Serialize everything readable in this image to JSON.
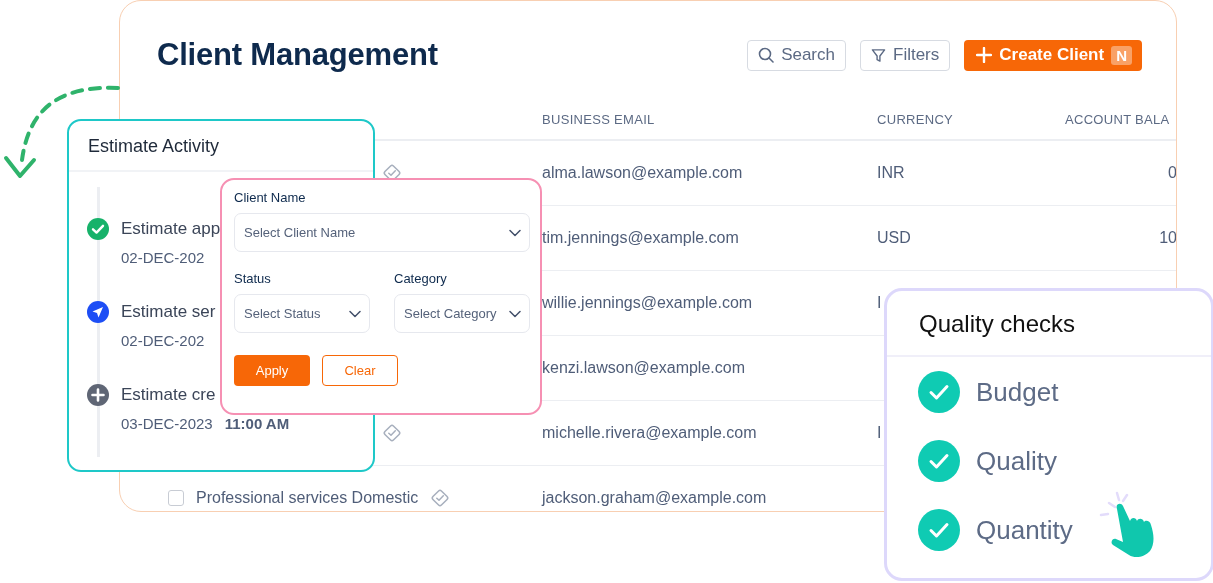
{
  "client_management": {
    "title": "Client Management",
    "toolbar": [
      {
        "kind": "search",
        "label": "Search"
      },
      {
        "kind": "filter",
        "label": "Filters"
      },
      {
        "kind": "create",
        "label": "Create Client",
        "shortcut": "N"
      }
    ],
    "table": {
      "columns": [
        "",
        "BUSINESS EMAIL",
        "CURRENCY",
        "ACCOUNT BALA"
      ],
      "rows": [
        {
          "business_name": "",
          "verified": true,
          "email": "alma.lawson@example.com",
          "currency": "INR",
          "balance": "0"
        },
        {
          "business_name": "",
          "email": "tim.jennings@example.com",
          "currency": "USD",
          "balance": "10"
        },
        {
          "business_name": "",
          "email": "willie.jennings@example.com",
          "currency": "I",
          "balance": ""
        },
        {
          "business_name": "",
          "email": "kenzi.lawson@example.com",
          "currency": "",
          "balance": ""
        },
        {
          "business_name": "",
          "verified": true,
          "email": "michelle.rivera@example.com",
          "currency": "I",
          "balance": ""
        },
        {
          "business_name": "Professional services Domestic",
          "verified": true,
          "checked": false,
          "email": "jackson.graham@example.com",
          "currency": "",
          "balance": ""
        }
      ]
    }
  },
  "estimate_activity": {
    "title": "Estimate Activity",
    "items": [
      {
        "kind": "approved",
        "label": "Estimate app",
        "date": "02-DEC-202"
      },
      {
        "kind": "sent",
        "label": "Estimate ser",
        "date": "02-DEC-202"
      },
      {
        "kind": "created",
        "label": "Estimate cre",
        "date": "03-DEC-2023",
        "time": "11:00 AM"
      }
    ]
  },
  "filter": {
    "fields": [
      {
        "label": "Client Name",
        "placeholder": "Select Client Name",
        "wide": true
      },
      {
        "label": "Status",
        "placeholder": "Select Status",
        "wide": false
      },
      {
        "label": "Category",
        "placeholder": "Select Category",
        "wide": false
      }
    ],
    "buttons": [
      {
        "kind": "primary",
        "label": "Apply"
      },
      {
        "kind": "secondary",
        "label": "Clear"
      }
    ]
  },
  "quality_checks": {
    "title": "Quality checks",
    "items": [
      {
        "label": "Budget",
        "checked": true
      },
      {
        "label": "Quality",
        "checked": true
      },
      {
        "label": "Quantity",
        "checked": true
      }
    ]
  }
}
